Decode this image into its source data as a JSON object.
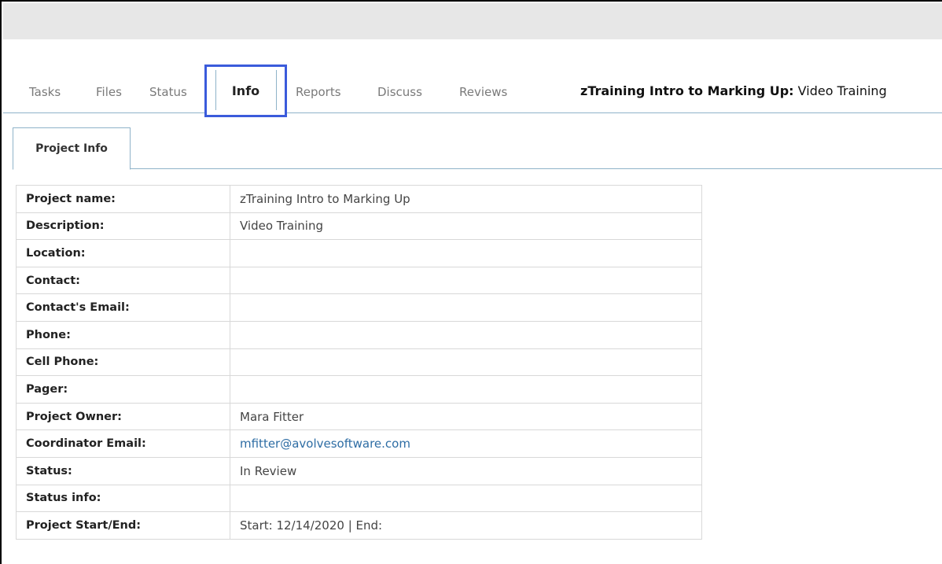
{
  "tabs": [
    {
      "label": "Tasks"
    },
    {
      "label": "Files"
    },
    {
      "label": "Status"
    },
    {
      "label": "Info"
    },
    {
      "label": "Reports"
    },
    {
      "label": "Discuss"
    },
    {
      "label": "Reviews"
    }
  ],
  "active_tab": "Info",
  "header": {
    "project_bold": "zTraining Intro to Marking Up:",
    "project_rest": "Video Training"
  },
  "subtab": {
    "label": "Project Info"
  },
  "info_rows": [
    {
      "label": "Project name:",
      "value": "zTraining Intro to Marking Up"
    },
    {
      "label": "Description:",
      "value": "Video Training"
    },
    {
      "label": "Location:",
      "value": ""
    },
    {
      "label": "Contact:",
      "value": ""
    },
    {
      "label": "Contact's Email:",
      "value": ""
    },
    {
      "label": "Phone:",
      "value": ""
    },
    {
      "label": "Cell Phone:",
      "value": ""
    },
    {
      "label": "Pager:",
      "value": ""
    },
    {
      "label": "Project Owner:",
      "value": "Mara Fitter"
    },
    {
      "label": "Coordinator Email:",
      "value": "mfitter@avolvesoftware.com"
    },
    {
      "label": "Status:",
      "value": "In Review"
    },
    {
      "label": "Status info:",
      "value": ""
    },
    {
      "label": "Project Start/End:",
      "value": "Start: 12/14/2020 | End:"
    }
  ],
  "colors": {
    "accent_highlight": "#3b5bdb",
    "link": "#2e6da4",
    "tab_border": "#8fb3c9",
    "topbar": "#e7e7e7"
  }
}
